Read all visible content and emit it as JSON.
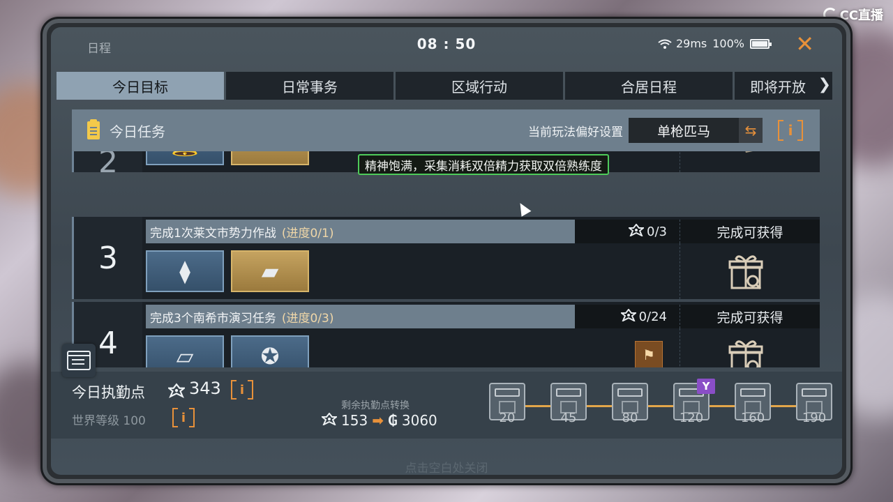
{
  "watermark": "CC直播",
  "status": {
    "app_title": "日程",
    "time": "08 : 50",
    "ping": "29ms",
    "battery": "100%",
    "battery_level": 1.0
  },
  "tabs": [
    {
      "label": "今日目标",
      "active": true
    },
    {
      "label": "日常事务",
      "active": false
    },
    {
      "label": "区域行动",
      "active": false
    },
    {
      "label": "合居日程",
      "active": false
    },
    {
      "label": "即将开放",
      "active": false
    }
  ],
  "section": {
    "title": "今日任务",
    "pref_label": "当前玩法偏好设置",
    "pref_value": "单枪匹马",
    "info": "i"
  },
  "tooltip": "精神饱满，采集消耗双倍精力获取双倍熟练度",
  "tasks": [
    {
      "num": "2",
      "title": "",
      "progress": "",
      "points": "",
      "reward_label": ""
    },
    {
      "num": "3",
      "title": "完成1次莱文市势力作战",
      "progress": "(进度0/1)",
      "points": "0/3",
      "reward_label": "完成可获得"
    },
    {
      "num": "4",
      "title": "完成3个南希市演习任务",
      "progress": "(进度0/3)",
      "points": "0/24",
      "reward_label": "完成可获得"
    }
  ],
  "footer": {
    "duty_label": "今日执勤点",
    "duty_value": "343",
    "world_label": "世界等级 100",
    "convert_label": "剩余执勤点转换",
    "convert_from": "153",
    "convert_to": "3060",
    "milestones": [
      "20",
      "45",
      "80",
      "120",
      "160",
      "190"
    ],
    "milestone_badge": "Y"
  },
  "close_hint": "点击空白处关闭",
  "icons": [
    "clipboard-icon",
    "swap-icon",
    "info-icon",
    "gift-icon",
    "calendar-icon",
    "duty-point-icon",
    "chest-icon",
    "wifi-icon",
    "battery-icon",
    "close-icon"
  ],
  "colors": {
    "accent": "#e8913a",
    "tab_active": "#8fa2b2",
    "tooltip_border": "#4ecb5a",
    "badge": "#8a4ec7"
  }
}
